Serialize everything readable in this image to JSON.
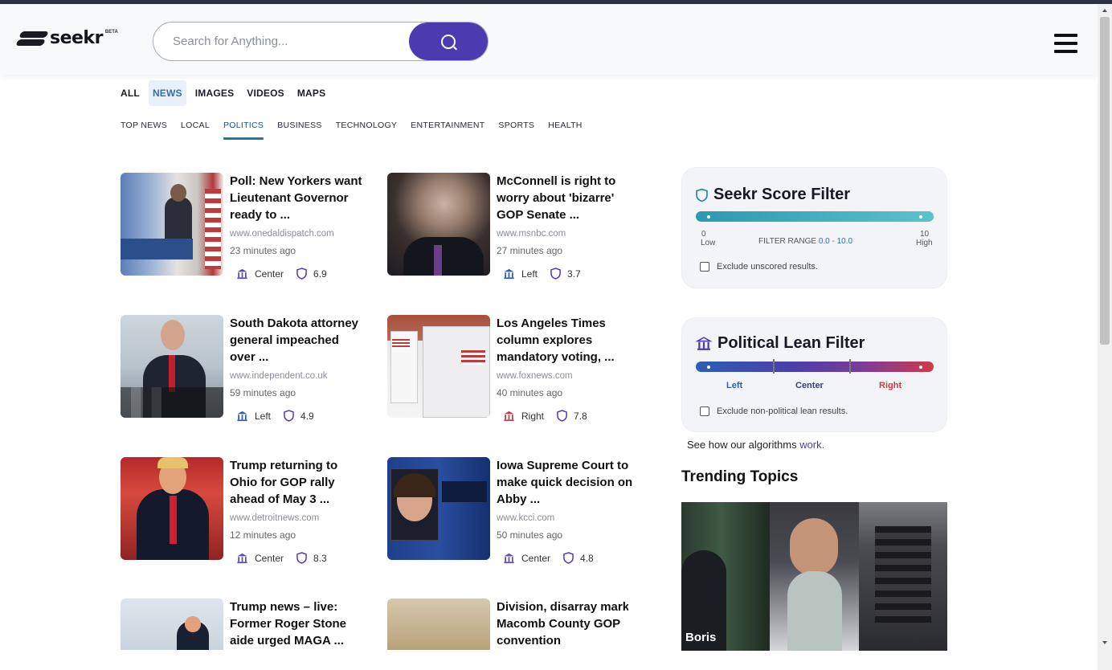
{
  "brand": {
    "name": "seekr",
    "beta": "BETA"
  },
  "search": {
    "placeholder": "Search for Anything..."
  },
  "tabs": [
    {
      "label": "ALL",
      "active": false
    },
    {
      "label": "NEWS",
      "active": true
    },
    {
      "label": "IMAGES",
      "active": false
    },
    {
      "label": "VIDEOS",
      "active": false
    },
    {
      "label": "MAPS",
      "active": false
    }
  ],
  "subtabs": [
    {
      "label": "TOP NEWS",
      "active": false
    },
    {
      "label": "LOCAL",
      "active": false
    },
    {
      "label": "POLITICS",
      "active": true
    },
    {
      "label": "BUSINESS",
      "active": false
    },
    {
      "label": "TECHNOLOGY",
      "active": false
    },
    {
      "label": "ENTERTAINMENT",
      "active": false
    },
    {
      "label": "SPORTS",
      "active": false
    },
    {
      "label": "HEALTH",
      "active": false
    }
  ],
  "articles": [
    {
      "title": "Poll: New Yorkers want Lieutenant Governor ready to ...",
      "source": "www.onedaldispatch.com",
      "time": "23 minutes ago",
      "lean": "Center",
      "score": "6.9"
    },
    {
      "title": "McConnell is right to worry about 'bizarre' GOP Senate ...",
      "source": "www.msnbc.com",
      "time": "27 minutes ago",
      "lean": "Left",
      "score": "3.7"
    },
    {
      "title": "South Dakota attorney general impeached over ...",
      "source": "www.independent.co.uk",
      "time": "59 minutes ago",
      "lean": "Left",
      "score": "4.9"
    },
    {
      "title": "Los Angeles Times column explores mandatory voting, ...",
      "source": "www.foxnews.com",
      "time": "40 minutes ago",
      "lean": "Right",
      "score": "7.8"
    },
    {
      "title": "Trump returning to Ohio for GOP rally ahead of May 3 ...",
      "source": "www.detroitnews.com",
      "time": "12 minutes ago",
      "lean": "Center",
      "score": "8.3"
    },
    {
      "title": "Iowa Supreme Court to make quick decision on Abby ...",
      "source": "www.kcci.com",
      "time": "50 minutes ago",
      "lean": "Center",
      "score": "4.8"
    },
    {
      "title": "Trump news – live: Former Roger Stone aide urged MAGA ...",
      "source": "",
      "time": "",
      "lean": "",
      "score": ""
    },
    {
      "title": "Division, disarray mark Macomb County GOP convention",
      "source": "",
      "time": "",
      "lean": "",
      "score": ""
    }
  ],
  "score_filter": {
    "title": "Seekr Score Filter",
    "min": "0",
    "min_label": "Low",
    "max": "10",
    "max_label": "High",
    "range_label": "FILTER RANGE",
    "range_value": "0.0 - 10.0",
    "exclude_label": "Exclude unscored results."
  },
  "lean_filter": {
    "title": "Political Lean Filter",
    "left": "Left",
    "center": "Center",
    "right": "Right",
    "exclude_label": "Exclude non-political lean results."
  },
  "algo_link": {
    "prefix": "See how our algorithms ",
    "link": "work."
  },
  "trending": {
    "title": "Trending Topics",
    "first_label": "Boris"
  },
  "colors": {
    "accent": "#4a3bb0",
    "left": "#2d5fb5",
    "center": "#6a3fa0",
    "right": "#c83a4a",
    "score_bar": "#3aa9b8"
  },
  "icons": [
    "hamburger-menu-icon",
    "search-icon",
    "bank-icon",
    "shield-icon"
  ]
}
